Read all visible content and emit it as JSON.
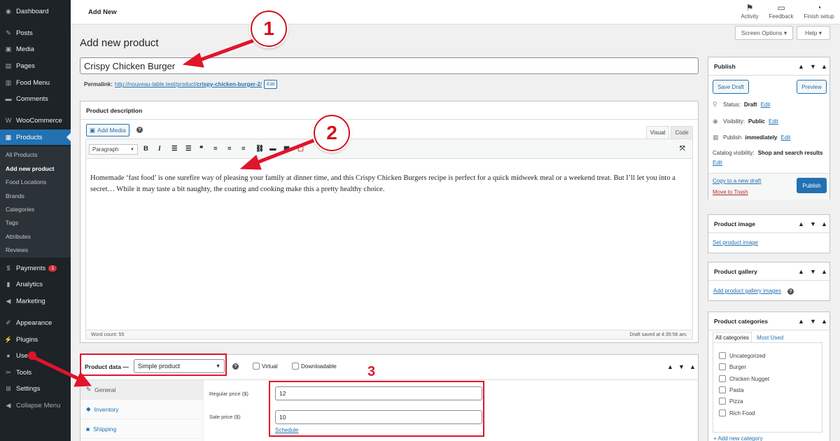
{
  "sidebar": {
    "items": [
      {
        "label": "Dashboard",
        "icon": "dashboard-icon",
        "glyph": "◉"
      },
      {
        "label": "Posts",
        "icon": "pin-icon",
        "glyph": "✎"
      },
      {
        "label": "Media",
        "icon": "media-icon",
        "glyph": "▣"
      },
      {
        "label": "Pages",
        "icon": "pages-icon",
        "glyph": "▤"
      },
      {
        "label": "Food Menu",
        "icon": "document-icon",
        "glyph": "▥"
      },
      {
        "label": "Comments",
        "icon": "comment-icon",
        "glyph": "▬"
      },
      {
        "label": "WooCommerce",
        "icon": "woo-icon",
        "glyph": "W"
      },
      {
        "label": "Products",
        "icon": "archive-icon",
        "glyph": "▦"
      },
      {
        "label": "Payments",
        "icon": "dollar-icon",
        "glyph": "$",
        "badge": "1"
      },
      {
        "label": "Analytics",
        "icon": "chart-icon",
        "glyph": "▮"
      },
      {
        "label": "Marketing",
        "icon": "megaphone-icon",
        "glyph": "◀"
      },
      {
        "label": "Appearance",
        "icon": "brush-icon",
        "glyph": "✐"
      },
      {
        "label": "Plugins",
        "icon": "plugin-icon",
        "glyph": "⚡"
      },
      {
        "label": "Users",
        "icon": "user-icon",
        "glyph": "●"
      },
      {
        "label": "Tools",
        "icon": "wrench-icon",
        "glyph": "✂"
      },
      {
        "label": "Settings",
        "icon": "settings-icon",
        "glyph": "⊞"
      },
      {
        "label": "Collapse Menu",
        "icon": "collapse-icon",
        "glyph": "◀"
      }
    ],
    "submenu": [
      "All Products",
      "Add new product",
      "Food Locations",
      "Brands",
      "Categories",
      "Tags",
      "Attributes",
      "Reviews"
    ]
  },
  "topbar": {
    "crumb": "Add New",
    "activity": "Activity",
    "feedback": "Feedback",
    "finish_setup": "Finish setup",
    "screen_options": "Screen Options ▾",
    "help": "Help ▾"
  },
  "page": {
    "title": "Add new product",
    "product_title": "Crispy Chicken Burger",
    "permalink_label": "Permalink:",
    "permalink_base": "http://nouveau-table.test/product/",
    "permalink_slug": "crispy-chicken-burger-2",
    "permalink_end": "/",
    "edit": "Edit"
  },
  "description": {
    "heading": "Product description",
    "add_media": "Add Media",
    "tab_visual": "Visual",
    "tab_code": "Code",
    "format": "Paragraph",
    "content": "Homemade ‘fast food’ is one surefire way of pleasing your family at dinner time, and this Crispy Chicken Burgers recipe is perfect for a quick midweek meal or a weekend treat. But I’ll let you into a secret… While it may taste a bit naughty, the coating and cooking make this a pretty healthy choice.",
    "word_count": "Word count: 55",
    "draft_saved": "Draft saved at 4:35:56 am."
  },
  "product_data": {
    "label": "Product data —",
    "type": "Simple product",
    "virtual": "Virtual",
    "downloadable": "Downloadable",
    "tabs": [
      "General",
      "Inventory",
      "Shipping"
    ],
    "regular_price_label": "Regular price ($)",
    "regular_price": "12",
    "sale_price_label": "Sale price ($)",
    "sale_price": "10",
    "schedule": "Schedule"
  },
  "publish": {
    "heading": "Publish",
    "save_draft": "Save Draft",
    "preview": "Preview",
    "status_label": "Status:",
    "status": "Draft",
    "visibility_label": "Visibility:",
    "visibility": "Public",
    "publish_label": "Publish",
    "publish_when": "immediately",
    "catalog_label": "Catalog visibility:",
    "catalog": "Shop and search results",
    "edit": "Edit",
    "copy_draft": "Copy to a new draft",
    "trash": "Move to Trash",
    "publish_btn": "Publish"
  },
  "product_image": {
    "heading": "Product image",
    "link": "Set product image"
  },
  "product_gallery": {
    "heading": "Product gallery",
    "link": "Add product gallery images"
  },
  "categories": {
    "heading": "Product categories",
    "tab_all": "All categories",
    "tab_used": "Most Used",
    "items": [
      "Uncategorized",
      "Burger",
      "Chicken Nugget",
      "Pasta",
      "Pizza",
      "Rich Food"
    ],
    "add_new": "+ Add new category"
  },
  "annotations": {
    "one": "1",
    "two": "2",
    "three": "3"
  },
  "colors": {
    "accent": "#2271b1",
    "sidebar": "#1d2327",
    "annotation_red": "#e0142a"
  }
}
